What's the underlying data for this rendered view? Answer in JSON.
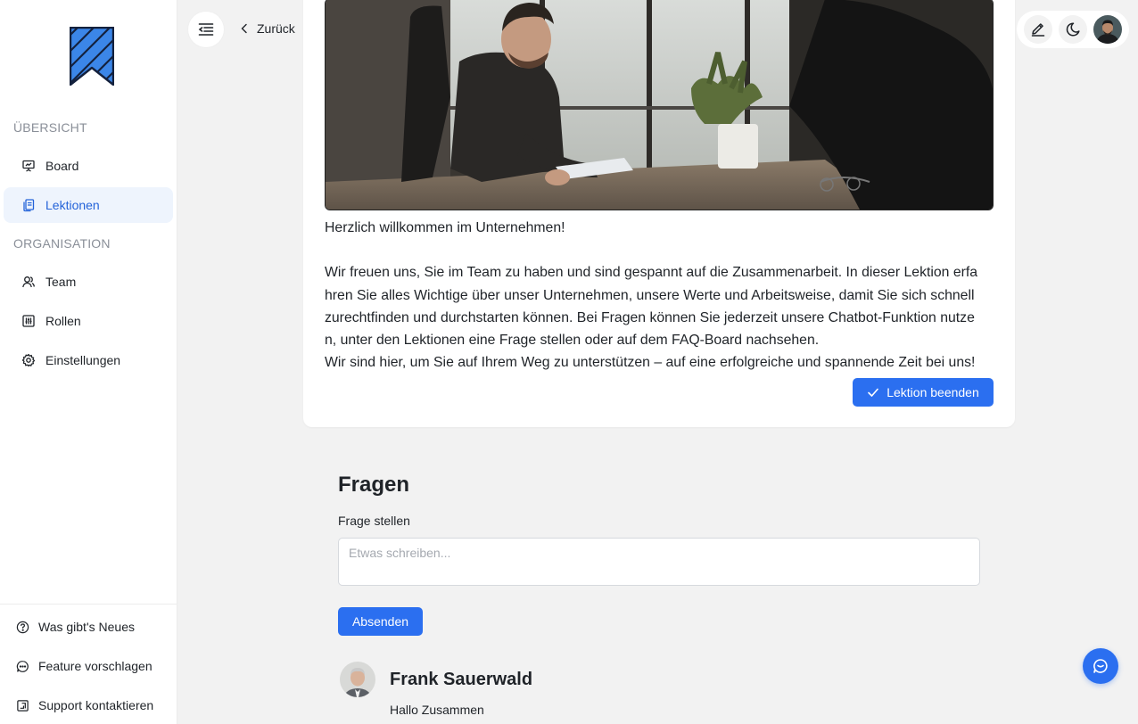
{
  "sidebar": {
    "logo_icon": "bookmark-logo",
    "sections": [
      {
        "title": "ÜBERSICHT"
      },
      {
        "title": "ORGANISATION"
      }
    ],
    "items": [
      {
        "label": "Board",
        "icon": "presentation-icon"
      },
      {
        "label": "Lektionen",
        "icon": "copy-icon",
        "active": true
      },
      {
        "label": "Team",
        "icon": "users-icon"
      },
      {
        "label": "Rollen",
        "icon": "sliders-icon"
      },
      {
        "label": "Einstellungen",
        "icon": "gear-icon"
      }
    ],
    "bottom_items": [
      {
        "label": "Was gibt's Neues",
        "icon": "help-circle-icon"
      },
      {
        "label": "Feature vorschlagen",
        "icon": "message-dots-icon"
      },
      {
        "label": "Support kontaktieren",
        "icon": "support-icon"
      }
    ]
  },
  "topbar": {
    "back_label": "Zurück",
    "menu_icon": "indent-menu-icon",
    "edit_icon": "pencil-icon",
    "theme_icon": "moon-icon"
  },
  "lesson": {
    "heading_line": "Herzlich willkommen im Unternehmen!",
    "paragraph_lines": [
      "Wir freuen uns, Sie im Team zu haben und sind gespannt auf die Zusammenarbeit. In dieser Lektion erfa",
      "hren Sie alles Wichtige über unser Unternehmen, unsere Werte und Arbeitsweise, damit Sie sich schnell",
      "zurechtfinden und durchstarten können. Bei Fragen können Sie jederzeit unsere Chatbot-Funktion nutze",
      "n, unter den Lektionen eine Frage stellen oder auf dem FAQ-Board nachsehen.",
      "Wir sind hier, um Sie auf Ihrem Weg zu unterstützen – auf eine erfolgreiche und spannende Zeit bei uns!"
    ],
    "finish_label": "Lektion beenden"
  },
  "questions": {
    "title": "Fragen",
    "input_label": "Frage stellen",
    "input_placeholder": "Etwas schreiben...",
    "input_value": "",
    "send_label": "Absenden",
    "comments": [
      {
        "author": "Frank Sauerwald",
        "text": "Hallo Zusammen"
      }
    ]
  },
  "colors": {
    "accent": "#2b6ff0",
    "active_bg": "#eef4fd",
    "active_text": "#2463d9",
    "page_bg": "#f2f2f2"
  }
}
